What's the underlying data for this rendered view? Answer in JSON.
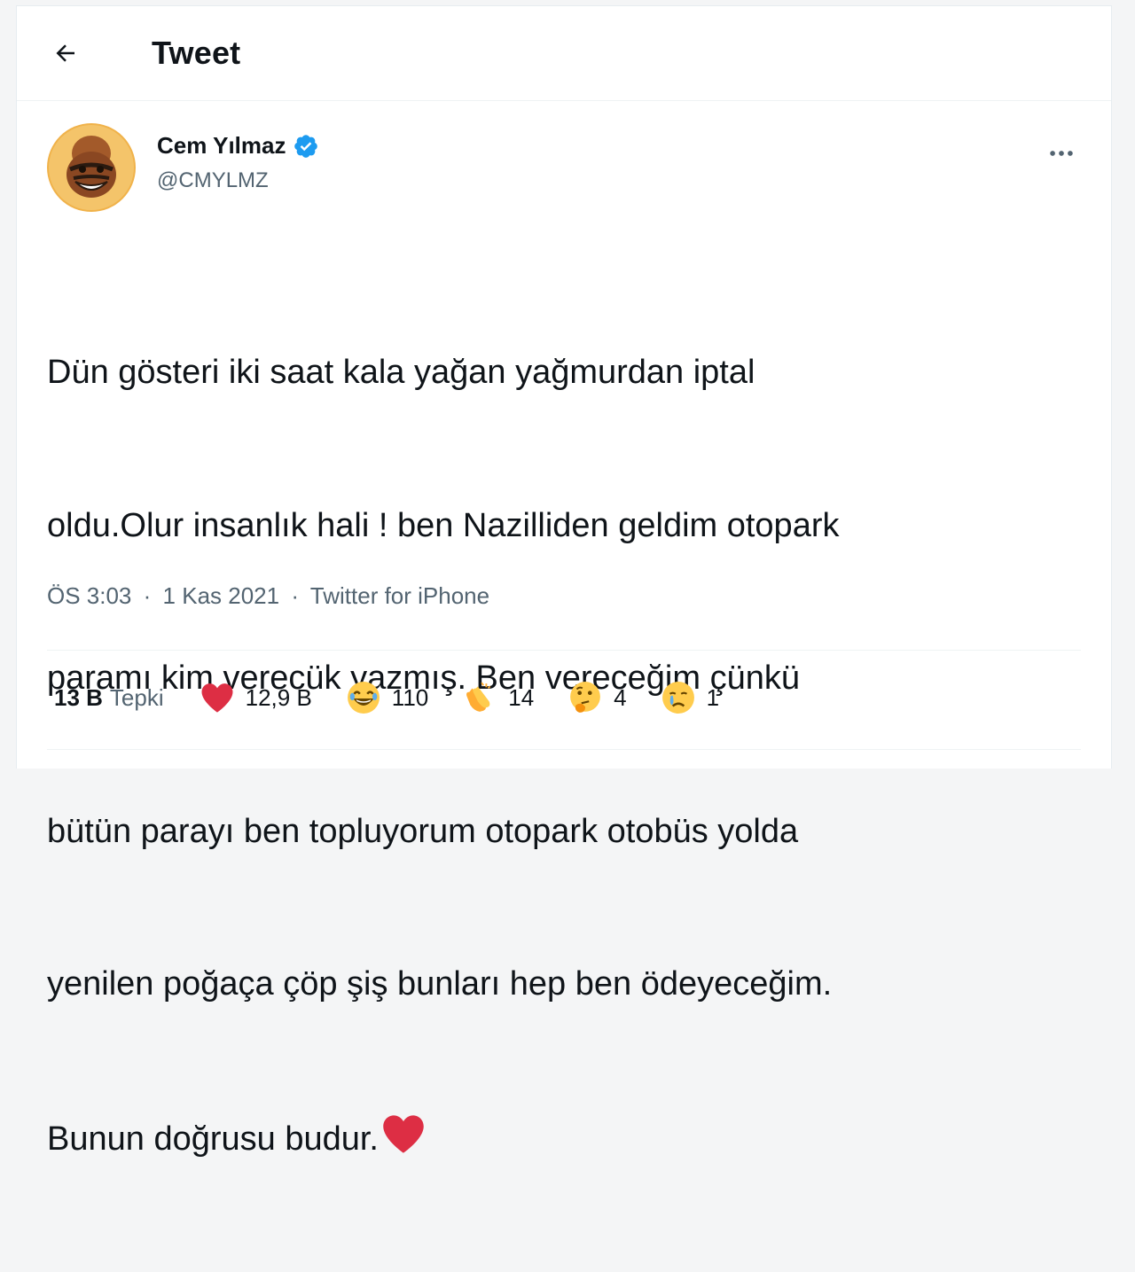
{
  "header": {
    "title": "Tweet",
    "back_icon": "arrow-left-icon"
  },
  "author": {
    "display_name": "Cem Yılmaz",
    "handle": "@CMYLMZ",
    "verified": true,
    "verified_color": "#1d9bf0"
  },
  "tweet": {
    "text_lines": [
      "Dün gösteri iki saat kala yağan yağmurdan iptal",
      "oldu.Olur insanlık hali ! ben Nazilliden geldim otopark",
      "paramı kim verecük yazmış. Ben vereceğim çünkü",
      "bütün parayı ben topluyorum otopark otobüs yolda",
      "yenilen poğaça çöp şiş bunları hep ben ödeyeceğim.",
      "Bunun doğrusu budur."
    ],
    "trailing_emoji": "red-heart-icon"
  },
  "meta": {
    "time": "ÖS 3:03",
    "date": "1 Kas 2021",
    "separator": "·",
    "source": "Twitter for iPhone"
  },
  "reactions": {
    "total_count": "13 B",
    "total_label": "Tepki",
    "items": [
      {
        "icon": "red-heart-icon",
        "count": "12,9 B"
      },
      {
        "icon": "laughing-face-icon",
        "count": "110"
      },
      {
        "icon": "clapping-hands-icon",
        "count": "14"
      },
      {
        "icon": "thinking-face-icon",
        "count": "4"
      },
      {
        "icon": "crying-face-icon",
        "count": "1"
      }
    ]
  },
  "colors": {
    "secondary_text": "#536471",
    "primary_text": "#0f1419",
    "heart": "#e0245e"
  }
}
